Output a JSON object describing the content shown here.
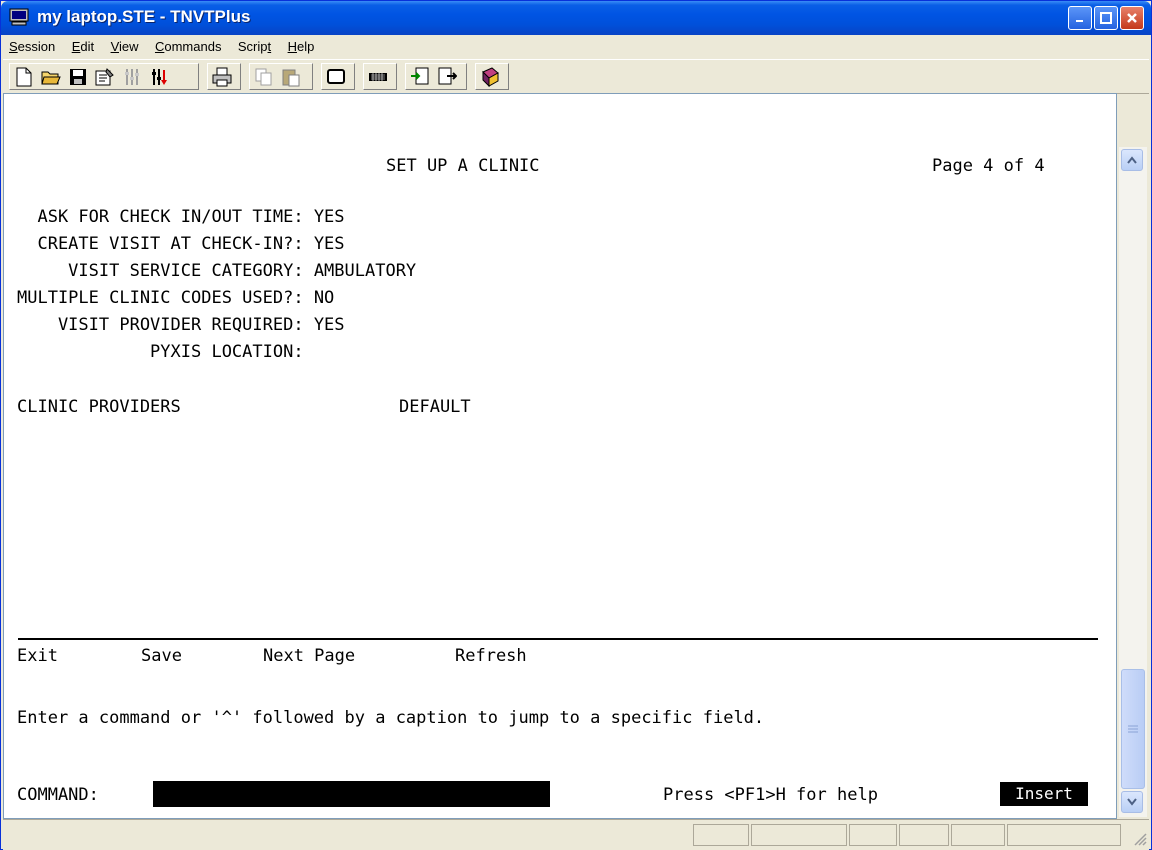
{
  "window": {
    "title": "my laptop.STE - TNVTPlus",
    "colors": {
      "titlebar": "#0054e3",
      "terminal_bg": "#ffffff",
      "terminal_fg": "#000000"
    }
  },
  "menu": {
    "items": [
      {
        "accel": "S",
        "rest": "ession"
      },
      {
        "accel": "E",
        "rest": "dit"
      },
      {
        "accel": "V",
        "rest": "iew"
      },
      {
        "accel": "C",
        "rest": "ommands"
      },
      {
        "pre": "Scrip",
        "accel": "t",
        "rest": ""
      },
      {
        "accel": "H",
        "rest": "elp"
      }
    ]
  },
  "toolbar": {
    "icons": [
      "new-file-icon",
      "open-folder-icon",
      "save-disk-icon",
      "properties-icon",
      "disconnect-icon",
      "connect-icon",
      "print-icon",
      "copy-icon",
      "paste-icon",
      "screen-icon",
      "keyboard-icon",
      "receive-file-icon",
      "send-file-icon",
      "help-book-icon"
    ]
  },
  "terminal": {
    "header_title": "SET UP A CLINIC",
    "page_indicator": "Page 4 of 4",
    "fields": [
      {
        "label": "  ASK FOR CHECK IN/OUT TIME:",
        "value": " YES"
      },
      {
        "label": "  CREATE VISIT AT CHECK-IN?:",
        "value": " YES"
      },
      {
        "label": "     VISIT SERVICE CATEGORY:",
        "value": " AMBULATORY"
      },
      {
        "label": "MULTIPLE CLINIC CODES USED?:",
        "value": " NO"
      },
      {
        "label": "    VISIT PROVIDER REQUIRED:",
        "value": " YES"
      },
      {
        "label": "             PYXIS LOCATION:",
        "value": ""
      }
    ],
    "providers_header": "CLINIC PROVIDERS",
    "default_header": "DEFAULT",
    "commands": [
      "Exit",
      "Save",
      "Next Page",
      "Refresh"
    ],
    "instruction": "Enter a command or '^' followed by a caption to jump to a specific field.",
    "command_label": "COMMAND:",
    "command_value": "",
    "help_hint": "Press <PF1>H for help",
    "mode": "Insert"
  }
}
